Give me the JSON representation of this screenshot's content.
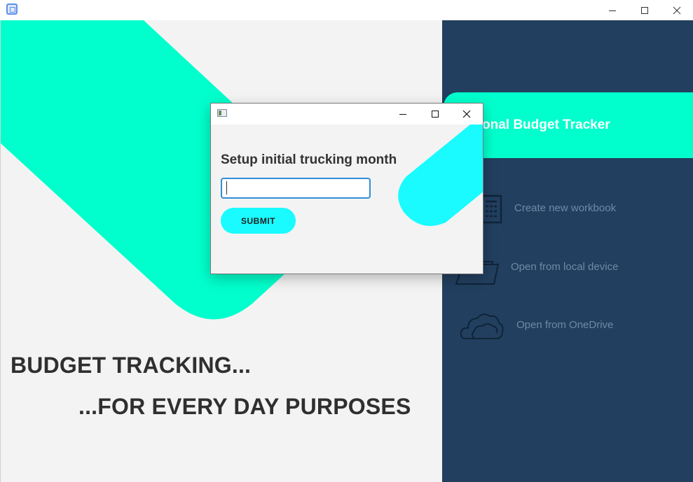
{
  "window": {
    "minimize_symbol": "—",
    "maximize_symbol": "☐",
    "close_symbol": "✕"
  },
  "hero": {
    "headline_1": "BUDGET TRACKING...",
    "headline_2": "...FOR EVERY DAY PURPOSES"
  },
  "sidebar": {
    "banner_title": "onal Budget Tracker",
    "items": [
      {
        "label": "Create new workbook",
        "icon": "spreadsheet-icon"
      },
      {
        "label": "Open from local device",
        "icon": "folder-icon"
      },
      {
        "label": "Open from OneDrive",
        "icon": "cloud-icon"
      }
    ]
  },
  "dialog": {
    "heading": "Setup initial trucking month",
    "input_value": "",
    "input_placeholder": "",
    "submit_label": "SUBMIT"
  },
  "colors": {
    "accent_mint": "#00ffcc",
    "accent_cyan": "#19fbff",
    "sidebar_bg": "#223f5f",
    "panel_bg": "#f3f3f3",
    "headline_text": "#2f2f2f",
    "menu_text": "#6f8aa6",
    "input_border": "#2e8fd6"
  }
}
